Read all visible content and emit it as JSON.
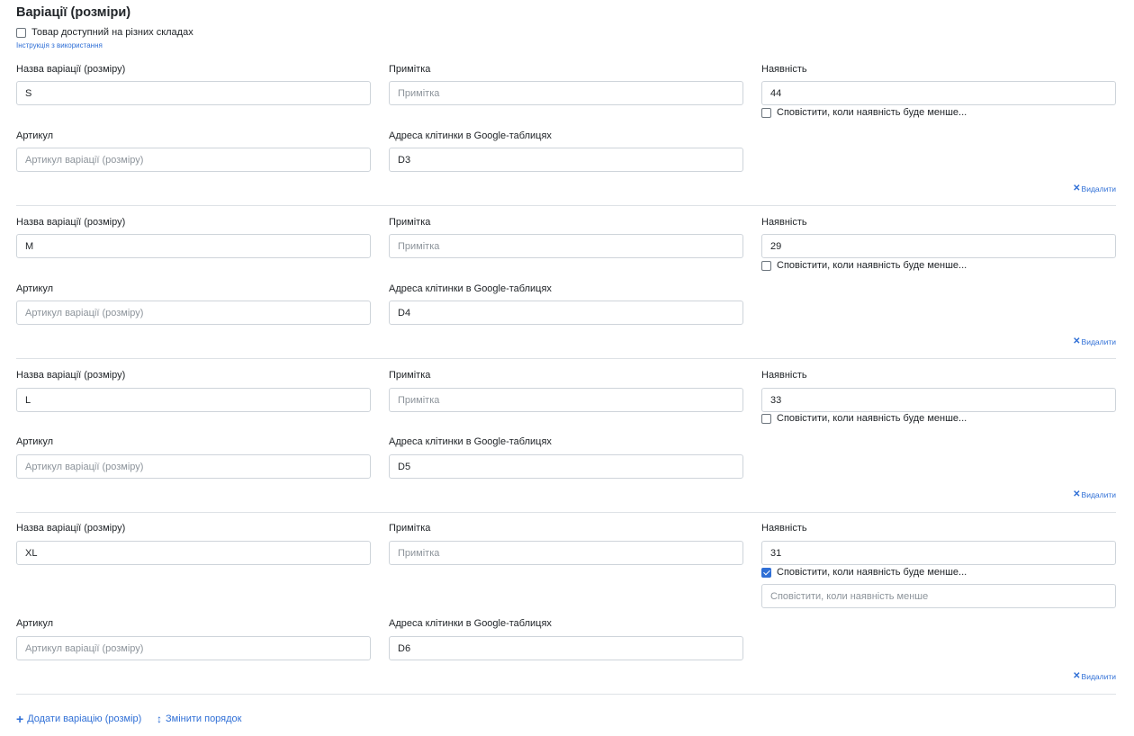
{
  "section": {
    "title": "Варіації (розміри)",
    "multi_warehouse_label": "Товар доступний на різних складах",
    "instructions_link": "Інструкція з використання"
  },
  "labels": {
    "name": "Назва варіації (розміру)",
    "note": "Примітка",
    "stock": "Наявність",
    "notify": "Сповістити, коли наявність буде менше...",
    "sku": "Артикул",
    "cell": "Адреса клітинки в Google-таблицях",
    "delete": "Видалити"
  },
  "placeholders": {
    "note": "Примітка",
    "sku": "Артикул варіації (розміру)",
    "notify_threshold": "Сповістити, коли наявність менше"
  },
  "variations": [
    {
      "name": "S",
      "note": "",
      "stock": "44",
      "sku": "",
      "cell": "D3",
      "notify": false
    },
    {
      "name": "M",
      "note": "",
      "stock": "29",
      "sku": "",
      "cell": "D4",
      "notify": false
    },
    {
      "name": "L",
      "note": "",
      "stock": "33",
      "sku": "",
      "cell": "D5",
      "notify": false
    },
    {
      "name": "XL",
      "note": "",
      "stock": "31",
      "sku": "",
      "cell": "D6",
      "notify": true
    }
  ],
  "actions": {
    "add_variation": "Додати варіацію (розмір)",
    "reorder": "Змінити порядок"
  },
  "icons": {
    "add": "plus-icon",
    "reorder": "vertical-arrows-icon",
    "delete": "close-icon"
  },
  "colors": {
    "accent": "#2f6fd6",
    "border": "#ced4da",
    "separator": "#dee2e6"
  }
}
